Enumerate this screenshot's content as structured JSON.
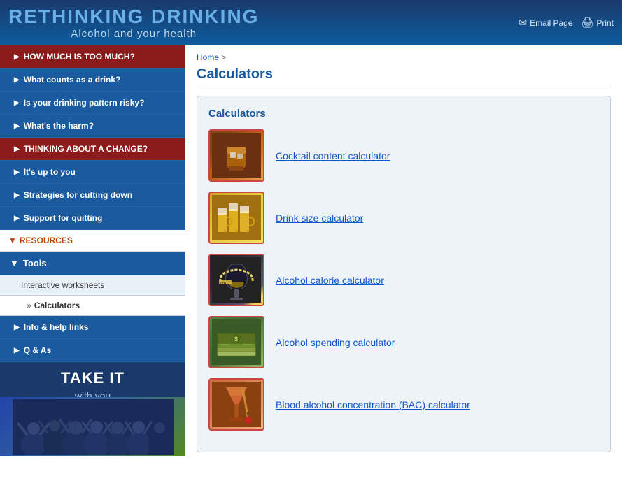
{
  "header": {
    "logo_rethinking": "RETHINKING",
    "logo_drinking": "DRINKING",
    "logo_subtitle": "Alcohol and your health",
    "email_label": "Email Page",
    "print_label": "Print"
  },
  "sidebar": {
    "nav_items": [
      {
        "id": "how-much",
        "label": "HOW MUCH IS TOO MUCH?",
        "style": "dark",
        "active": false
      },
      {
        "id": "what-counts",
        "label": "What counts as a drink?",
        "style": "medium",
        "active": false
      },
      {
        "id": "risky-pattern",
        "label": "Is your drinking pattern risky?",
        "style": "medium",
        "active": false
      },
      {
        "id": "harm",
        "label": "What's the harm?",
        "style": "medium",
        "active": false
      },
      {
        "id": "thinking",
        "label": "THINKING ABOUT A CHANGE?",
        "style": "dark-red",
        "active": true
      },
      {
        "id": "up-to-you",
        "label": "It's up to you",
        "style": "medium",
        "active": false
      },
      {
        "id": "strategies",
        "label": "Strategies for cutting down",
        "style": "medium",
        "active": false
      },
      {
        "id": "quitting",
        "label": "Support for quitting",
        "style": "medium",
        "active": false
      }
    ],
    "resources_label": "RESOURCES",
    "tools_label": "Tools",
    "interactive_worksheets_label": "Interactive worksheets",
    "calculators_label": "Calculators",
    "info_help_label": "Info & help links",
    "qas_label": "Q & As",
    "takeit_line1": "TAKE IT",
    "takeit_line2": "with you"
  },
  "breadcrumb": {
    "home_label": "Home",
    "separator": ">"
  },
  "main": {
    "page_title": "Calculators",
    "box_title": "Calculators",
    "calculators": [
      {
        "id": "cocktail",
        "label": "Cocktail content calculator",
        "thumb_type": "whiskey"
      },
      {
        "id": "drink-size",
        "label": "Drink size calculator",
        "thumb_type": "beer"
      },
      {
        "id": "calorie",
        "label": "Alcohol calorie calculator",
        "thumb_type": "glass"
      },
      {
        "id": "spending",
        "label": "Alcohol spending calculator",
        "thumb_type": "money"
      },
      {
        "id": "bac",
        "label": "Blood alcohol concentration (BAC) calculator",
        "thumb_type": "cocktail"
      }
    ]
  }
}
